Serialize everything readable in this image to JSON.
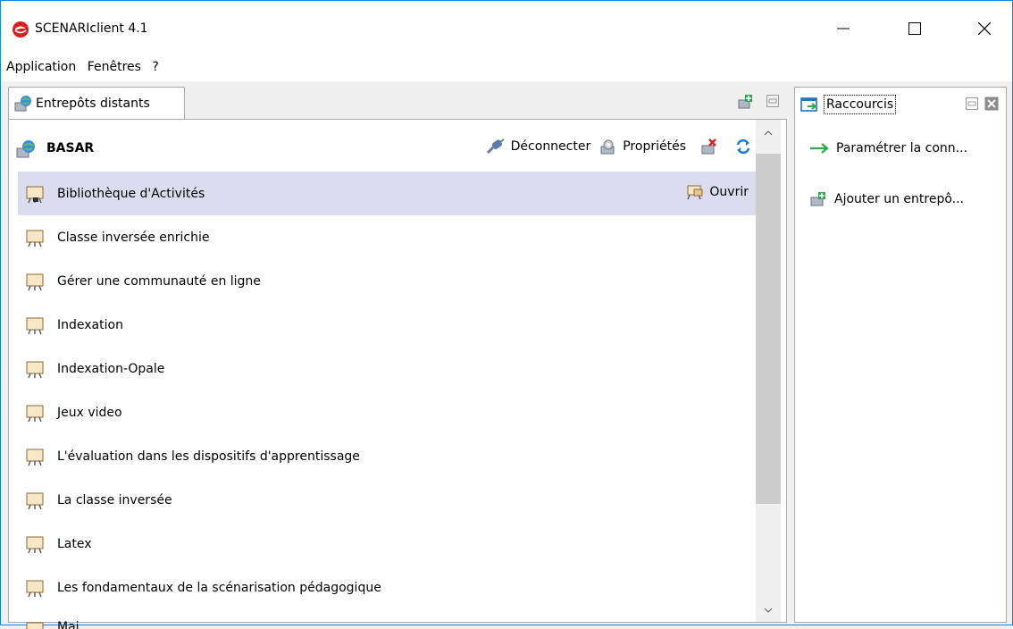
{
  "window": {
    "title": "SCENARIclient 4.1"
  },
  "menu": {
    "items": [
      "Application",
      "Fenêtres",
      "?"
    ]
  },
  "left_panel": {
    "tab_label": "Entrepôts distants",
    "repository": {
      "name": "BASAR",
      "actions": {
        "disconnect": "Déconnecter",
        "properties": "Propriétés"
      }
    },
    "open_label": "Ouvrir",
    "items": [
      {
        "label": "Bibliothèque d'Activités",
        "selected": true
      },
      {
        "label": "Classe inversée enrichie"
      },
      {
        "label": "Gérer une communauté en ligne"
      },
      {
        "label": "Indexation"
      },
      {
        "label": "Indexation-Opale"
      },
      {
        "label": "Jeux video"
      },
      {
        "label": "L'évaluation dans les dispositifs d'apprentissage"
      },
      {
        "label": "La classe inversée"
      },
      {
        "label": "Latex"
      },
      {
        "label": "Les fondamentaux de la scénarisation pédagogique"
      },
      {
        "label": "Maj..."
      }
    ]
  },
  "right_panel": {
    "tab_label": "Raccourcis",
    "shortcuts": [
      {
        "label": "Paramétrer la conn...",
        "icon": "arrow-right-icon"
      },
      {
        "label": "Ajouter un entrepô...",
        "icon": "add-repository-icon"
      }
    ]
  },
  "colors": {
    "selection": "#dcdcef",
    "window_border": "#1883d7",
    "panel_border": "#a9a9a9"
  }
}
